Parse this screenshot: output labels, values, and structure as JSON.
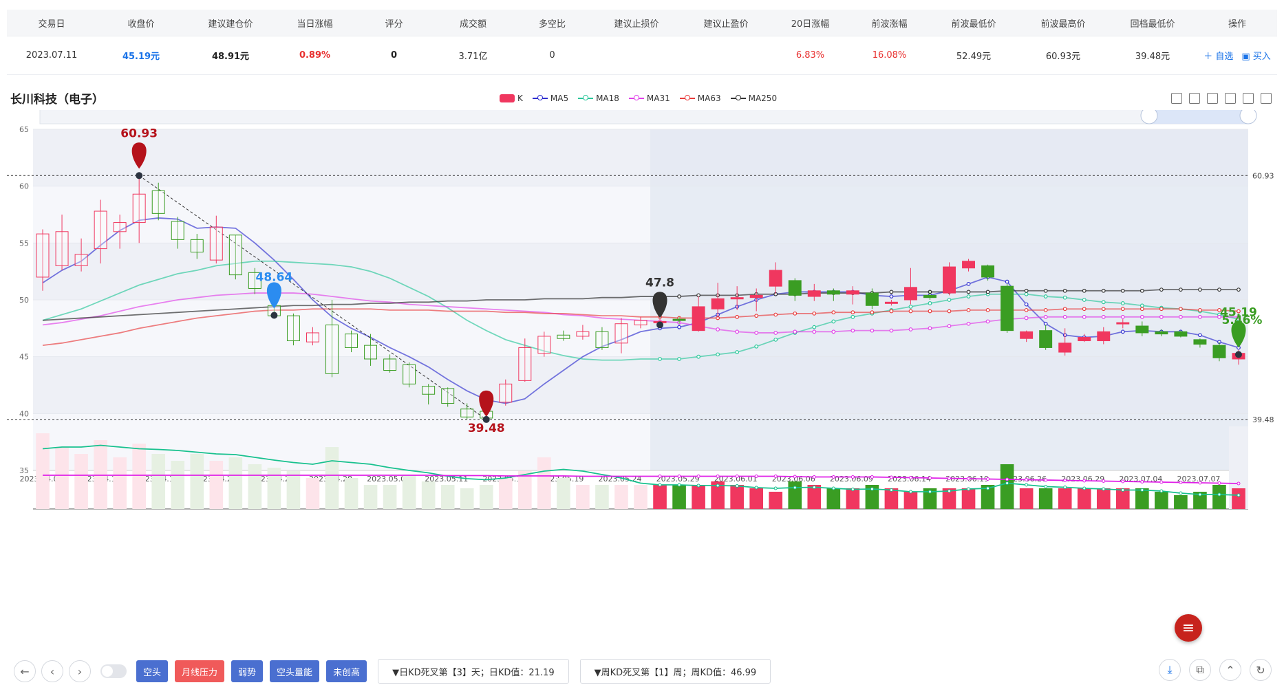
{
  "table": {
    "headers": [
      "交易日",
      "收盘价",
      "建议建仓价",
      "当日涨幅",
      "评分",
      "成交额",
      "多空比",
      "建议止损价",
      "建议止盈价",
      "20日涨幅",
      "前波涨幅",
      "前波最低价",
      "前波最高价",
      "回档最低价",
      "操作"
    ],
    "row": {
      "date": "2023.07.11",
      "close": "45.19元",
      "entry": "48.91元",
      "day_change": "0.89%",
      "score": "0",
      "turnover": "3.71亿",
      "ratio": "0",
      "stop_loss": "",
      "take_profit": "",
      "change20": "6.83%",
      "wave_change": "16.08%",
      "wave_low": "52.49元",
      "wave_high": "60.93元",
      "pullback_low": "39.48元",
      "op_watch": "＋ 自选",
      "op_buy": "▣ 买入"
    }
  },
  "chart_title": "长川科技（电子）",
  "legend": [
    {
      "name": "K",
      "color": "#f0375f"
    },
    {
      "name": "MA5",
      "color": "#2f2fd0"
    },
    {
      "name": "MA18",
      "color": "#2ac79a"
    },
    {
      "name": "MA31",
      "color": "#e040e8"
    },
    {
      "name": "MA63",
      "color": "#e83b3b"
    },
    {
      "name": "MA250",
      "color": "#333333"
    }
  ],
  "toolbar_icons": [
    "refresh-icon",
    "crop-icon",
    "undo-crop-icon",
    "restore-icon",
    "zoom-select-icon",
    "download-icon"
  ],
  "chart_data": {
    "type": "candlestick",
    "y_ticks": [
      "65",
      "60",
      "55",
      "50",
      "45",
      "40",
      "35"
    ],
    "ylim": [
      35,
      65
    ],
    "x_ticks": [
      "2023.04.07",
      "2023.04.12",
      "2023.04.17",
      "2023.04.20",
      "2023.04.25",
      "2023.04.28",
      "2023.05.08",
      "2023.05.11",
      "2023.05.16",
      "2023.05.19",
      "2023.05.24",
      "2023.05.29",
      "2023.06.01",
      "2023.06.06",
      "2023.06.09",
      "2023.06.14",
      "2023.06.19",
      "2023.06.26",
      "2023.06.29",
      "2023.07.04",
      "2023.07.07"
    ],
    "hlines": [
      {
        "value": 60.93,
        "label": "60.93"
      },
      {
        "value": 39.48,
        "label": "39.48"
      }
    ],
    "markers": [
      {
        "label": "60.93",
        "value": 60.93,
        "color": "#b5121b",
        "index": 5
      },
      {
        "label": "48.64",
        "value": 48.64,
        "color": "#2b8cf0",
        "index": 12
      },
      {
        "label": "39.48",
        "value": 39.48,
        "color": "#b5121b",
        "index": 23
      },
      {
        "label": "47.8",
        "value": 47.8,
        "color": "#333333",
        "index": 32
      },
      {
        "label": "45.19",
        "value": 45.19,
        "color": "#3a9d23",
        "index": 62
      },
      {
        "label": "5.46%",
        "value": null,
        "color": "#3a9d23",
        "index": 62
      }
    ],
    "highlight_start_index": 32,
    "candles": [
      [
        52,
        55.8,
        50.8,
        56.2
      ],
      [
        53,
        56,
        52.6,
        57.5
      ],
      [
        53,
        54,
        52.5,
        55.4
      ],
      [
        54.5,
        57.8,
        53.2,
        58.8
      ],
      [
        56,
        56.8,
        54.5,
        57.5
      ],
      [
        56.8,
        59.3,
        55,
        60.9
      ],
      [
        59.6,
        57.6,
        57,
        60.3
      ],
      [
        56.9,
        55.3,
        54.5,
        57.3
      ],
      [
        55.3,
        54.2,
        53.6,
        55.8
      ],
      [
        53.5,
        56.4,
        53.2,
        57.4
      ],
      [
        55.7,
        52.2,
        51.8,
        55.7
      ],
      [
        52.4,
        51,
        50.5,
        52.8
      ],
      [
        49.5,
        48.6,
        48.4,
        50.2
      ],
      [
        48.6,
        46.4,
        46,
        48.8
      ],
      [
        46.3,
        47.1,
        46,
        47.6
      ],
      [
        47.8,
        43.5,
        43.2,
        50
      ],
      [
        47,
        45.8,
        45.4,
        47.3
      ],
      [
        46,
        44.8,
        44.2,
        47
      ],
      [
        44.8,
        43.8,
        43.6,
        45.2
      ],
      [
        44.3,
        42.6,
        42.3,
        44.5
      ],
      [
        42.4,
        41.7,
        40.8,
        42.6
      ],
      [
        42.2,
        40.9,
        40.6,
        42.3
      ],
      [
        40.4,
        39.7,
        39.5,
        40.9
      ],
      [
        40.2,
        39.6,
        39.48,
        40.3
      ],
      [
        41,
        42.6,
        40.7,
        43
      ],
      [
        42.9,
        45.8,
        42.8,
        46.6
      ],
      [
        45.3,
        46.8,
        45,
        47.2
      ],
      [
        46.9,
        46.6,
        46.4,
        47.3
      ],
      [
        46.8,
        47.2,
        46.5,
        47.8
      ],
      [
        47.2,
        45.8,
        45.6,
        47.6
      ],
      [
        46.2,
        47.9,
        45.3,
        48.4
      ],
      [
        47.8,
        48.2,
        47.5,
        48.5
      ],
      [
        48.1,
        48.1,
        47.8,
        48.3
      ],
      [
        48.3,
        48.2,
        47.9,
        48.5
      ],
      [
        47.3,
        49.4,
        47.2,
        50.3
      ],
      [
        49.2,
        50.1,
        48.4,
        51.5
      ],
      [
        50.1,
        50.2,
        49.1,
        51.2
      ],
      [
        50.2,
        50.4,
        49,
        51
      ],
      [
        51.2,
        52.6,
        50.5,
        53.3
      ],
      [
        51.7,
        50.4,
        49.9,
        51.9
      ],
      [
        50.3,
        50.8,
        49.9,
        51.4
      ],
      [
        50.8,
        50.5,
        49.9,
        51
      ],
      [
        50.5,
        50.8,
        49.6,
        51.2
      ],
      [
        50.6,
        49.5,
        49.2,
        51
      ],
      [
        49.8,
        49.8,
        49.5,
        50
      ],
      [
        50,
        51.1,
        49.6,
        52.8
      ],
      [
        50.4,
        50.2,
        50,
        50.8
      ],
      [
        50.6,
        52.9,
        50.4,
        53.3
      ],
      [
        52.8,
        53.4,
        52.5,
        53.6
      ],
      [
        53,
        52,
        51.7,
        53.1
      ],
      [
        51.2,
        47.3,
        47.1,
        51.4
      ],
      [
        46.6,
        47.2,
        46.3,
        47.3
      ],
      [
        47.3,
        45.8,
        45.6,
        47.8
      ],
      [
        45.4,
        46.2,
        45.1,
        47.5
      ],
      [
        46.4,
        46.7,
        46.3,
        47
      ],
      [
        46.4,
        47.2,
        46.1,
        47.6
      ],
      [
        48,
        48,
        47.5,
        48.3
      ],
      [
        47.7,
        47.1,
        46.8,
        48.1
      ],
      [
        47.2,
        47,
        46.8,
        47.4
      ],
      [
        47.2,
        46.8,
        46.7,
        47.3
      ],
      [
        46.5,
        46.1,
        45.8,
        46.6
      ],
      [
        46,
        44.9,
        44.6,
        46.3
      ],
      [
        44.8,
        45.3,
        44.3,
        45.6
      ]
    ],
    "ma": {
      "MA5": [
        51.5,
        52.6,
        53.4,
        54.8,
        56.1,
        57,
        57.2,
        57.1,
        56.3,
        56.4,
        56.3,
        55,
        53.5,
        51.8,
        50,
        48.5,
        47.5,
        46.7,
        45.8,
        45,
        44.1,
        43,
        42,
        41.2,
        40.9,
        41.3,
        42.6,
        43.8,
        45,
        45.9,
        46.5,
        47.2,
        47.5,
        47.6,
        48,
        48.7,
        49.4,
        50,
        50.5,
        50.7,
        50.7,
        50.7,
        50.7,
        50.4,
        50.3,
        50.4,
        50.4,
        50.8,
        51.4,
        52,
        51.6,
        49.6,
        47.9,
        46.9,
        46.7,
        46.8,
        47.2,
        47.3,
        47.2,
        47.2,
        46.9,
        46.3,
        45.8
      ],
      "MA18": [
        48.2,
        48.7,
        49.2,
        49.9,
        50.6,
        51.3,
        51.8,
        52.3,
        52.6,
        53,
        53.2,
        53.4,
        53.4,
        53.3,
        53.2,
        53.1,
        52.9,
        52.5,
        51.9,
        51.1,
        50.3,
        49.3,
        48.2,
        47.3,
        46.5,
        46,
        45.5,
        45.1,
        44.8,
        44.7,
        44.7,
        44.8,
        44.8,
        44.8,
        45,
        45.2,
        45.4,
        45.9,
        46.5,
        47.1,
        47.6,
        48.1,
        48.5,
        48.8,
        49.1,
        49.4,
        49.7,
        50,
        50.3,
        50.5,
        50.5,
        50.5,
        50.3,
        50.2,
        50,
        49.8,
        49.7,
        49.5,
        49.3,
        49.2,
        49,
        48.7,
        48.3
      ],
      "MA31": [
        47.8,
        48,
        48.3,
        48.6,
        49,
        49.4,
        49.7,
        50,
        50.2,
        50.4,
        50.5,
        50.6,
        50.6,
        50.6,
        50.5,
        50.3,
        50.1,
        49.9,
        49.8,
        49.6,
        49.5,
        49.4,
        49.3,
        49.2,
        49.1,
        49,
        48.9,
        48.7,
        48.6,
        48.4,
        48.3,
        48.2,
        48.1,
        48,
        47.7,
        47.4,
        47.2,
        47.1,
        47.1,
        47.2,
        47.2,
        47.2,
        47.3,
        47.3,
        47.3,
        47.4,
        47.5,
        47.7,
        47.9,
        48.1,
        48.3,
        48.4,
        48.5,
        48.5,
        48.5,
        48.5,
        48.5,
        48.5,
        48.5,
        48.5,
        48.5,
        48.5,
        48.5
      ],
      "MA63": [
        46,
        46.2,
        46.5,
        46.8,
        47.1,
        47.5,
        47.8,
        48.1,
        48.4,
        48.6,
        48.8,
        49,
        49.1,
        49.1,
        49.2,
        49.2,
        49.2,
        49.2,
        49.1,
        49.1,
        49.1,
        49,
        49,
        49,
        48.9,
        48.9,
        48.8,
        48.8,
        48.7,
        48.6,
        48.6,
        48.5,
        48.5,
        48.4,
        48.4,
        48.4,
        48.5,
        48.6,
        48.7,
        48.8,
        48.8,
        48.9,
        48.9,
        48.9,
        49,
        49,
        49,
        49,
        49.1,
        49.1,
        49.1,
        49.1,
        49.1,
        49.2,
        49.2,
        49.2,
        49.2,
        49.2,
        49.2,
        49.2,
        49.1,
        49.1,
        49
      ],
      "MA250": [
        48.2,
        48.3,
        48.4,
        48.5,
        48.6,
        48.7,
        48.8,
        48.9,
        49,
        49.1,
        49.2,
        49.3,
        49.4,
        49.5,
        49.5,
        49.6,
        49.6,
        49.7,
        49.7,
        49.8,
        49.8,
        49.9,
        49.9,
        50,
        50,
        50,
        50.1,
        50.1,
        50.1,
        50.2,
        50.2,
        50.3,
        50.3,
        50.3,
        50.4,
        50.4,
        50.4,
        50.5,
        50.5,
        50.5,
        50.6,
        50.6,
        50.6,
        50.6,
        50.7,
        50.7,
        50.7,
        50.7,
        50.7,
        50.7,
        50.8,
        50.8,
        50.8,
        50.8,
        50.8,
        50.8,
        50.8,
        50.8,
        50.9,
        50.9,
        50.9,
        50.9,
        50.9
      ]
    },
    "volume": [
      2.2,
      1.8,
      1.6,
      2,
      1.5,
      1.9,
      1.6,
      1.4,
      1.6,
      1.4,
      1.5,
      1.3,
      1.2,
      1.1,
      0.9,
      1.8,
      0.9,
      0.7,
      0.7,
      1,
      0.8,
      0.7,
      0.6,
      0.7,
      0.9,
      1.1,
      1.5,
      0.9,
      0.7,
      0.7,
      0.7,
      0.7,
      0.7,
      0.7,
      0.7,
      0.8,
      0.7,
      0.6,
      0.5,
      0.8,
      0.7,
      0.6,
      0.6,
      0.7,
      0.6,
      0.5,
      0.6,
      0.6,
      0.6,
      0.7,
      1.3,
      0.6,
      0.6,
      0.6,
      0.6,
      0.6,
      0.6,
      0.6,
      0.5,
      0.4,
      0.5,
      0.7,
      0.6
    ],
    "volume_line1": [
      1.75,
      1.8,
      1.8,
      1.85,
      1.8,
      1.75,
      1.73,
      1.7,
      1.65,
      1.6,
      1.58,
      1.5,
      1.42,
      1.35,
      1.3,
      1.4,
      1.35,
      1.3,
      1.2,
      1.12,
      1.05,
      0.95,
      0.88,
      0.85,
      0.9,
      1,
      1.1,
      1.15,
      1.1,
      1,
      0.9,
      0.75,
      0.7,
      0.7,
      0.68,
      0.68,
      0.67,
      0.62,
      0.6,
      0.62,
      0.63,
      0.6,
      0.57,
      0.58,
      0.55,
      0.5,
      0.5,
      0.52,
      0.58,
      0.6,
      0.75,
      0.7,
      0.65,
      0.63,
      0.6,
      0.58,
      0.55,
      0.55,
      0.52,
      0.46,
      0.42,
      0.42,
      0.4
    ],
    "volume_line2": [
      0.98,
      0.98,
      0.98,
      0.98,
      0.98,
      0.98,
      0.98,
      0.98,
      0.98,
      0.98,
      0.98,
      0.98,
      0.98,
      0.98,
      0.98,
      0.98,
      0.98,
      0.98,
      0.98,
      0.98,
      0.98,
      0.97,
      0.97,
      0.97,
      0.96,
      0.96,
      0.96,
      0.96,
      0.95,
      0.95,
      0.95,
      0.95,
      0.95,
      0.95,
      0.95,
      0.95,
      0.95,
      0.95,
      0.95,
      0.94,
      0.93,
      0.93,
      0.93,
      0.93,
      0.92,
      0.91,
      0.9,
      0.89,
      0.88,
      0.87,
      0.86,
      0.85,
      0.84,
      0.83,
      0.82,
      0.81,
      0.8,
      0.79,
      0.78,
      0.77,
      0.76,
      0.75,
      0.74
    ]
  },
  "bottom": {
    "nav": [
      "‹",
      "‹",
      "›"
    ],
    "tags": [
      {
        "label": "空头",
        "style": "b"
      },
      {
        "label": "月线压力",
        "style": "r"
      },
      {
        "label": "弱势",
        "style": "b"
      },
      {
        "label": "空头量能",
        "style": "b"
      },
      {
        "label": "未创高",
        "style": "b"
      }
    ],
    "info1": "▼日KD死叉第【3】天；日KD值：21.19",
    "info2": "▼周KD死叉第【1】周；周KD值：46.99"
  }
}
